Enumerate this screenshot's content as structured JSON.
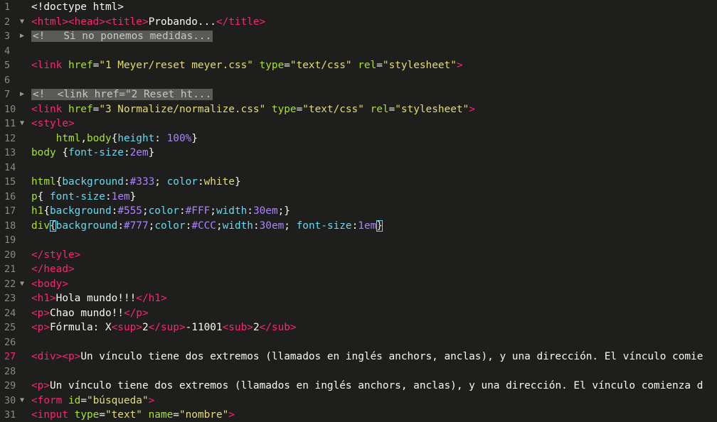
{
  "lines": [
    {
      "n": "1",
      "fold": "",
      "err": false,
      "parts": [
        [
          "t-punct",
          "<!doctype html>"
        ]
      ]
    },
    {
      "n": "2",
      "fold": "v",
      "err": false,
      "parts": [
        [
          "t-tag",
          "<html><head><title>"
        ],
        [
          "t-plain",
          "Probando..."
        ],
        [
          "t-tag",
          "</title>"
        ]
      ]
    },
    {
      "n": "3",
      "fold": ">",
      "err": false,
      "parts": [
        [
          "fold-comment",
          "<!   Si no ponemos medidas..."
        ]
      ]
    },
    {
      "n": "4",
      "fold": "",
      "err": false,
      "parts": []
    },
    {
      "n": "5",
      "fold": "",
      "err": false,
      "parts": [
        [
          "t-tag",
          "<link "
        ],
        [
          "t-attr",
          "href"
        ],
        [
          "t-plain",
          "="
        ],
        [
          "t-str",
          "\"1 Meyer/reset meyer.css\""
        ],
        [
          "t-plain",
          " "
        ],
        [
          "t-attr",
          "type"
        ],
        [
          "t-plain",
          "="
        ],
        [
          "t-str",
          "\"text/css\""
        ],
        [
          "t-plain",
          " "
        ],
        [
          "t-attr",
          "rel"
        ],
        [
          "t-plain",
          "="
        ],
        [
          "t-str",
          "\"stylesheet\""
        ],
        [
          "t-tag",
          ">"
        ]
      ]
    },
    {
      "n": "6",
      "fold": "",
      "err": false,
      "parts": []
    },
    {
      "n": "7",
      "fold": ">",
      "err": false,
      "parts": [
        [
          "fold-comment",
          "<!  <link href=\"2 Reset ht..."
        ]
      ]
    },
    {
      "n": "10",
      "fold": "",
      "err": false,
      "parts": [
        [
          "t-tag",
          "<link "
        ],
        [
          "t-attr",
          "href"
        ],
        [
          "t-plain",
          "="
        ],
        [
          "t-str",
          "\"3 Normalize/normalize.css\""
        ],
        [
          "t-plain",
          " "
        ],
        [
          "t-attr",
          "type"
        ],
        [
          "t-plain",
          "="
        ],
        [
          "t-str",
          "\"text/css\""
        ],
        [
          "t-plain",
          " "
        ],
        [
          "t-attr",
          "rel"
        ],
        [
          "t-plain",
          "="
        ],
        [
          "t-str",
          "\"stylesheet\""
        ],
        [
          "t-tag",
          ">"
        ]
      ]
    },
    {
      "n": "11",
      "fold": "v",
      "err": false,
      "parts": [
        [
          "t-tag",
          "<style>"
        ]
      ]
    },
    {
      "n": "12",
      "fold": "",
      "err": false,
      "parts": [
        [
          "t-plain",
          "    "
        ],
        [
          "t-sel",
          "html"
        ],
        [
          "t-plain",
          ","
        ],
        [
          "t-sel",
          "body"
        ],
        [
          "t-plain",
          "{"
        ],
        [
          "t-prop",
          "height"
        ],
        [
          "t-plain",
          ": "
        ],
        [
          "t-num",
          "100%"
        ],
        [
          "t-plain",
          "}"
        ]
      ]
    },
    {
      "n": "13",
      "fold": "",
      "err": false,
      "parts": [
        [
          "t-sel",
          "body"
        ],
        [
          "t-plain",
          " {"
        ],
        [
          "t-prop",
          "font-size"
        ],
        [
          "t-plain",
          ":"
        ],
        [
          "t-num",
          "2em"
        ],
        [
          "t-plain",
          "}"
        ]
      ]
    },
    {
      "n": "14",
      "fold": "",
      "err": false,
      "parts": []
    },
    {
      "n": "15",
      "fold": "",
      "err": false,
      "parts": [
        [
          "t-sel",
          "html"
        ],
        [
          "t-plain",
          "{"
        ],
        [
          "t-prop",
          "background"
        ],
        [
          "t-plain",
          ":"
        ],
        [
          "t-num",
          "#333"
        ],
        [
          "t-plain",
          "; "
        ],
        [
          "t-prop",
          "color"
        ],
        [
          "t-plain",
          ":"
        ],
        [
          "t-val",
          "white"
        ],
        [
          "t-plain",
          "}"
        ]
      ]
    },
    {
      "n": "16",
      "fold": "",
      "err": false,
      "parts": [
        [
          "t-sel",
          "p"
        ],
        [
          "t-plain",
          "{ "
        ],
        [
          "t-prop",
          "font-size"
        ],
        [
          "t-plain",
          ":"
        ],
        [
          "t-num",
          "1em"
        ],
        [
          "t-plain",
          "}"
        ]
      ]
    },
    {
      "n": "17",
      "fold": "",
      "err": false,
      "parts": [
        [
          "t-sel",
          "h1"
        ],
        [
          "t-plain",
          "{"
        ],
        [
          "t-prop",
          "background"
        ],
        [
          "t-plain",
          ":"
        ],
        [
          "t-num",
          "#555"
        ],
        [
          "t-plain",
          ";"
        ],
        [
          "t-prop",
          "color"
        ],
        [
          "t-plain",
          ":"
        ],
        [
          "t-num",
          "#FFF"
        ],
        [
          "t-plain",
          ";"
        ],
        [
          "t-prop",
          "width"
        ],
        [
          "t-plain",
          ":"
        ],
        [
          "t-num",
          "30em"
        ],
        [
          "t-plain",
          ";}"
        ]
      ]
    },
    {
      "n": "18",
      "fold": "",
      "err": false,
      "parts": [
        [
          "t-sel",
          "div"
        ],
        [
          "bracket",
          "{"
        ],
        [
          "t-prop",
          "background"
        ],
        [
          "t-plain",
          ":"
        ],
        [
          "t-num",
          "#777"
        ],
        [
          "t-plain",
          ";"
        ],
        [
          "t-prop",
          "color"
        ],
        [
          "t-plain",
          ":"
        ],
        [
          "t-num",
          "#CCC"
        ],
        [
          "t-plain",
          ";"
        ],
        [
          "t-prop",
          "width"
        ],
        [
          "t-plain",
          ":"
        ],
        [
          "t-num",
          "30em"
        ],
        [
          "t-plain",
          "; "
        ],
        [
          "t-prop",
          "font-size"
        ],
        [
          "t-plain",
          ":"
        ],
        [
          "t-num",
          "1em"
        ],
        [
          "bracket",
          "}"
        ]
      ]
    },
    {
      "n": "19",
      "fold": "",
      "err": false,
      "parts": []
    },
    {
      "n": "20",
      "fold": "",
      "err": false,
      "parts": [
        [
          "t-tag",
          "</style>"
        ]
      ]
    },
    {
      "n": "21",
      "fold": "",
      "err": false,
      "parts": [
        [
          "t-tag",
          "</head>"
        ]
      ]
    },
    {
      "n": "22",
      "fold": "v",
      "err": false,
      "parts": [
        [
          "t-tag",
          "<body>"
        ]
      ]
    },
    {
      "n": "23",
      "fold": "",
      "err": false,
      "parts": [
        [
          "t-tag",
          "<h1>"
        ],
        [
          "t-plain",
          "Hola mundo!!!"
        ],
        [
          "t-tag",
          "</h1>"
        ]
      ]
    },
    {
      "n": "24",
      "fold": "",
      "err": false,
      "parts": [
        [
          "t-tag",
          "<p>"
        ],
        [
          "t-plain",
          "Chao mundo!!"
        ],
        [
          "t-tag",
          "</p>"
        ]
      ]
    },
    {
      "n": "25",
      "fold": "",
      "err": false,
      "parts": [
        [
          "t-tag",
          "<p>"
        ],
        [
          "t-plain",
          "Fórmula: X"
        ],
        [
          "t-tag",
          "<sup>"
        ],
        [
          "t-plain",
          "2"
        ],
        [
          "t-tag",
          "</sup>"
        ],
        [
          "t-plain",
          "-11001"
        ],
        [
          "t-tag",
          "<sub>"
        ],
        [
          "t-plain",
          "2"
        ],
        [
          "t-tag",
          "</sub>"
        ]
      ]
    },
    {
      "n": "26",
      "fold": "",
      "err": false,
      "parts": []
    },
    {
      "n": "27",
      "fold": "",
      "err": true,
      "parts": [
        [
          "t-tag",
          "<div><p>"
        ],
        [
          "t-plain",
          "Un vínculo tiene dos extremos (llamados en inglés anchors, anclas), y una dirección. El vínculo comie"
        ]
      ]
    },
    {
      "n": "28",
      "fold": "",
      "err": false,
      "parts": []
    },
    {
      "n": "29",
      "fold": "",
      "err": false,
      "parts": [
        [
          "t-tag",
          "<p>"
        ],
        [
          "t-plain",
          "Un vínculo tiene dos extremos (llamados en inglés anchors, anclas), y una dirección. El vínculo comienza d"
        ]
      ]
    },
    {
      "n": "30",
      "fold": "v",
      "err": false,
      "parts": [
        [
          "t-tag",
          "<form "
        ],
        [
          "t-attr",
          "id"
        ],
        [
          "t-plain",
          "="
        ],
        [
          "t-str",
          "\"búsqueda\""
        ],
        [
          "t-tag",
          ">"
        ]
      ]
    },
    {
      "n": "31",
      "fold": "",
      "err": false,
      "parts": [
        [
          "t-tag",
          "<input "
        ],
        [
          "t-attr",
          "type"
        ],
        [
          "t-plain",
          "="
        ],
        [
          "t-str",
          "\"text\""
        ],
        [
          "t-plain",
          " "
        ],
        [
          "t-attr",
          "name"
        ],
        [
          "t-plain",
          "="
        ],
        [
          "t-str",
          "\"nombre\""
        ],
        [
          "t-tag",
          ">"
        ]
      ]
    }
  ]
}
